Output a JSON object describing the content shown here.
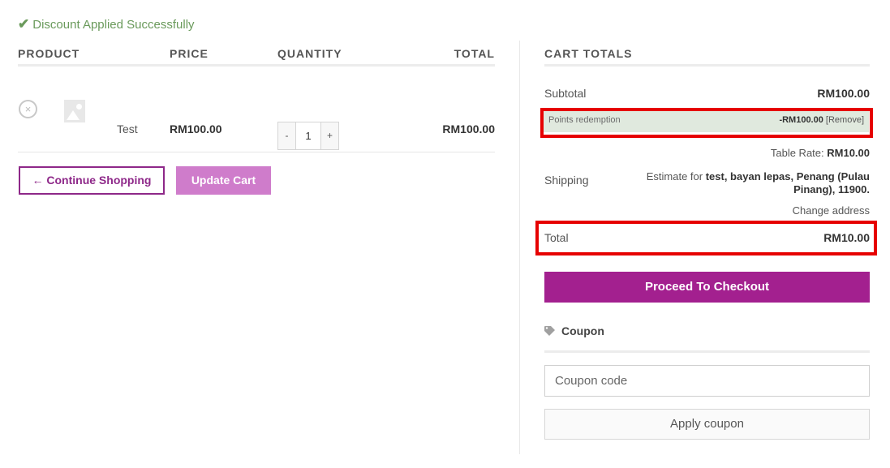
{
  "notice": {
    "text": "Discount Applied Successfully",
    "icon": "check-icon"
  },
  "cart": {
    "headers": {
      "product": "PRODUCT",
      "price": "PRICE",
      "quantity": "QUANTITY",
      "total": "TOTAL"
    },
    "items": [
      {
        "remove_symbol": "×",
        "name": "Test",
        "price": "RM100.00",
        "quantity": "1",
        "minus": "-",
        "plus": "+",
        "total": "RM100.00"
      }
    ],
    "continue_label": "← Continue Shopping",
    "update_label": "Update Cart"
  },
  "totals": {
    "title": "CART TOTALS",
    "subtotal_label": "Subtotal",
    "subtotal_value": "RM100.00",
    "points_label": "Points redemption",
    "points_value": "-RM100.00",
    "points_remove": "[Remove]",
    "table_rate_label": "Table Rate:",
    "table_rate_value": "RM10.00",
    "shipping_label": "Shipping",
    "shipping_estimate_prefix": "Estimate for",
    "shipping_address": "test, bayan lepas, Penang (Pulau Pinang), 11900.",
    "change_address": "Change address",
    "total_label": "Total",
    "total_value": "RM10.00",
    "checkout_label": "Proceed To Checkout"
  },
  "coupon": {
    "heading": "Coupon",
    "placeholder": "Coupon code",
    "apply_label": "Apply coupon"
  },
  "colors": {
    "accent": "#a3208f",
    "update_button": "#cf7ccb",
    "success": "#6a9a5b",
    "highlight_box": "#e60000",
    "points_row_bg": "#e0e9de"
  }
}
